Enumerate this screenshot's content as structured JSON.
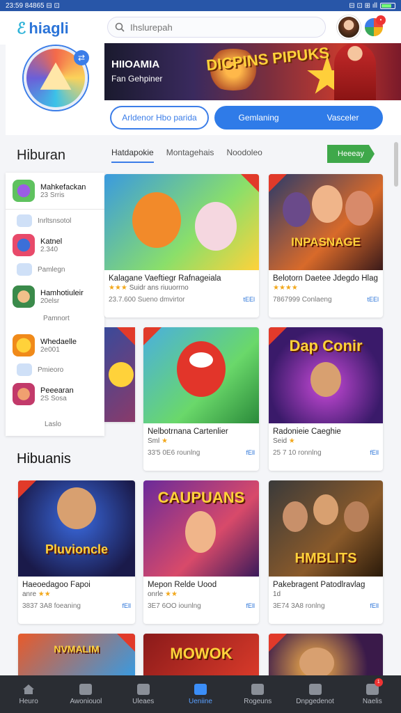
{
  "status": {
    "left": "23:59 84865 ⊟ ⊡",
    "right": "⊟ ⊡ ⊞ ıll"
  },
  "header": {
    "logo_text": "hiagli",
    "search_placeholder": "Ihslurepah"
  },
  "banner": {
    "title": "HIIOAMIA",
    "subtitle": "Fan Gehpiner",
    "art_text": "DICPINS PIPUKS"
  },
  "buttons": {
    "outline": "Arldenor Hbo parida",
    "solid_left": "Gemlaning",
    "solid_right": "Vasceler"
  },
  "sidebar": {
    "heading": "Hiburan",
    "items": [
      {
        "title": "Mahkefackan",
        "sub": "23 Srris"
      },
      {
        "label": "Inrltsnsotol"
      },
      {
        "title": "Katnel",
        "sub": "2.340"
      },
      {
        "label": "Pamlegn"
      },
      {
        "title": "Hamhotiuleir",
        "sub": "20elsr"
      },
      {
        "label": "Pamnort"
      },
      {
        "title": "Whedaelle",
        "sub": "2e001"
      },
      {
        "label": "Pmieoro"
      },
      {
        "title": "Peeearan",
        "sub": "2S Sosa"
      },
      {
        "label": "Laslo"
      }
    ]
  },
  "tabs": [
    "Hatdapokie",
    "Montagehais",
    "Noodoleo"
  ],
  "tab_button": "Heeeay",
  "section_heading": "Hibuanis",
  "cards": [
    {
      "title": "Kalagane Vaeftiegr Rafnageiala",
      "stars": "★★★",
      "meta": "Suidr ans riuuorrno",
      "footer": "23.7.600 Sueno dmvirtor",
      "badge": "tEEl",
      "word": ""
    },
    {
      "title": "Belotorn Daetee Jdegdo Hlag",
      "stars": "★★★★",
      "meta": "",
      "footer": "7867999 Conlaeng",
      "badge": "tEEl",
      "word": "INPASNAGE"
    },
    {
      "title": "",
      "stars": "",
      "meta": "",
      "footer": "",
      "badge": "",
      "word": ""
    },
    {
      "title": "Nelbotrnana Cartenlier",
      "stars": "★",
      "meta": "Sml",
      "footer": "33'5 0E6 rounlng",
      "badge": "fEll",
      "word": ""
    },
    {
      "title": "Radonieie Caeghie",
      "stars": "★",
      "meta": "Seid",
      "footer": "25 7 10 ronnlng",
      "badge": "fEll",
      "word": "Dap Conir"
    },
    {
      "title": "Haeoedagoo Fapoi",
      "stars": "★★",
      "meta": "anre",
      "footer": "3837 3A8 foeaning",
      "badge": "fEll",
      "word": "Pluvioncle"
    },
    {
      "title": "Mepon Relde Uood",
      "stars": "★★",
      "meta": "onrle",
      "footer": "3E7 6OO iounlng",
      "badge": "fEll",
      "word": "CAUPUANS"
    },
    {
      "title": "Pakebragent Patodlravlag",
      "stars": "",
      "meta": "1d",
      "footer": "3E74 3A8 ronlng",
      "badge": "fEll",
      "word": "HMBLITS"
    },
    {
      "title": "",
      "stars": "",
      "meta": "",
      "footer": "",
      "badge": "",
      "word": "NVMALIM"
    },
    {
      "title": "",
      "stars": "",
      "meta": "",
      "footer": "",
      "badge": "",
      "word": "MOWOK"
    },
    {
      "title": "",
      "stars": "",
      "meta": "",
      "footer": "",
      "badge": "",
      "word": ""
    }
  ],
  "nav": [
    {
      "label": "Heuro"
    },
    {
      "label": "Awoniouol"
    },
    {
      "label": "Uleaes"
    },
    {
      "label": "Ueniine"
    },
    {
      "label": "Rogeuns"
    },
    {
      "label": "Dnpgedenot"
    },
    {
      "label": "Naelis",
      "badge": "1"
    }
  ]
}
